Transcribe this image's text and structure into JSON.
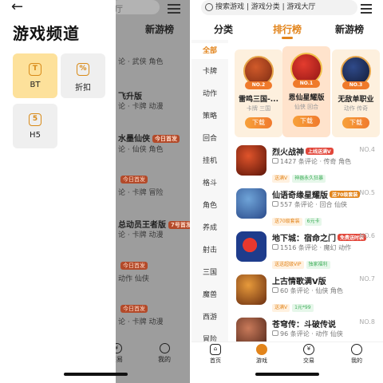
{
  "left": {
    "drawer_title": "游戏频道",
    "channels": [
      {
        "icon": "t-square-icon",
        "glyph": "T",
        "label": "BT"
      },
      {
        "icon": "percent-icon",
        "glyph": "%",
        "label": "折扣"
      },
      {
        "icon": "html5-icon",
        "glyph": "5",
        "label": "H5"
      }
    ],
    "bg": {
      "search_text": "厅",
      "tab": "新游榜",
      "lines": [
        {
          "text": "论 · 武侠 角色",
          "cls": ""
        },
        {
          "text": "飞升版",
          "cls": "title"
        },
        {
          "text": "论 · 卡牌 动漫",
          "cls": ""
        },
        {
          "text": "水墨仙侠",
          "cls": "title",
          "tag": "今日首发",
          "tagcls": ""
        },
        {
          "text": "论 · 仙侠 角色",
          "cls": ""
        },
        {
          "text": "今日首发",
          "cls": "",
          "tag": "",
          "tagcls": ""
        },
        {
          "text": "论 · 卡牌 冒险",
          "cls": ""
        },
        {
          "text": "总动员王者版",
          "cls": "title",
          "tag": "7号首发",
          "tagcls": ""
        },
        {
          "text": "论 · 卡牌 动漫",
          "cls": ""
        },
        {
          "text": "今日首发",
          "cls": ""
        },
        {
          "text": "动作 仙侠",
          "cls": ""
        },
        {
          "text": "今日首发",
          "cls": ""
        },
        {
          "text": "论 · 卡牌 动漫",
          "cls": ""
        }
      ],
      "nav_trade": "交易",
      "nav_mine": "我的"
    }
  },
  "right": {
    "search_placeholder": "搜索游戏 | 游戏分类 | 游戏大厅",
    "tabs": [
      "分类",
      "排行榜",
      "新游榜"
    ],
    "categories": [
      "全部",
      "卡牌",
      "动作",
      "策略",
      "回合",
      "挂机",
      "格斗",
      "角色",
      "养成",
      "射击",
      "三国",
      "魔兽",
      "西游",
      "冒险"
    ],
    "podium": [
      {
        "rank": "NO.2",
        "name": "雷鸣三国-...",
        "sub": "卡牌 三国",
        "btn": "下载"
      },
      {
        "rank": "NO.1",
        "name": "恩仙星耀版",
        "sub": "仙侠 回合",
        "btn": "下载"
      },
      {
        "rank": "NO.3",
        "name": "无敌单职业",
        "sub": "动作 传奇",
        "btn": "下载"
      }
    ],
    "rows": [
      {
        "name": "烈火战神",
        "badge": "上线送满V",
        "badge_color": "#e2463a",
        "rank": "NO.4",
        "meta": "1427 条评论 · 传奇 角色",
        "tags": [
          {
            "t": "送满V",
            "c": "t-orange"
          },
          {
            "t": "神器永久狂暴",
            "c": "t-green"
          }
        ]
      },
      {
        "name": "仙语奇缘星耀版",
        "badge": "送70级套装",
        "badge_color": "#e2841b",
        "rank": "NO.5",
        "meta": "557 条评论 · 回合 仙侠",
        "tags": [
          {
            "t": "送70级套装",
            "c": "t-orange"
          },
          {
            "t": "6元卡",
            "c": "t-green"
          }
        ]
      },
      {
        "name": "地下城：宿命之门",
        "badge": "免费送时装",
        "badge_color": "#e2463a",
        "rank": "NO.6",
        "meta": "1516 条评论 · 魔幻 动作",
        "tags": [
          {
            "t": "送送超级VIP",
            "c": "t-orange"
          },
          {
            "t": "独家福利",
            "c": "t-green"
          }
        ]
      },
      {
        "name": "上古情歌满V版",
        "badge": "",
        "badge_color": "",
        "rank": "NO.7",
        "meta": "60 条评论 · 仙侠 角色",
        "tags": [
          {
            "t": "送满V",
            "c": "t-orange"
          },
          {
            "t": "1元*99",
            "c": "t-green"
          }
        ]
      },
      {
        "name": "苍穹传：斗破传说",
        "badge": "",
        "badge_color": "",
        "rank": "NO.8",
        "meta": "96 条评论 · 动作 仙侠",
        "tags": []
      }
    ],
    "nav": [
      "首页",
      "游戏",
      "交易",
      "我的"
    ]
  },
  "colors": {
    "accent": "#e2841b",
    "drawer_active": "#fde19b"
  }
}
